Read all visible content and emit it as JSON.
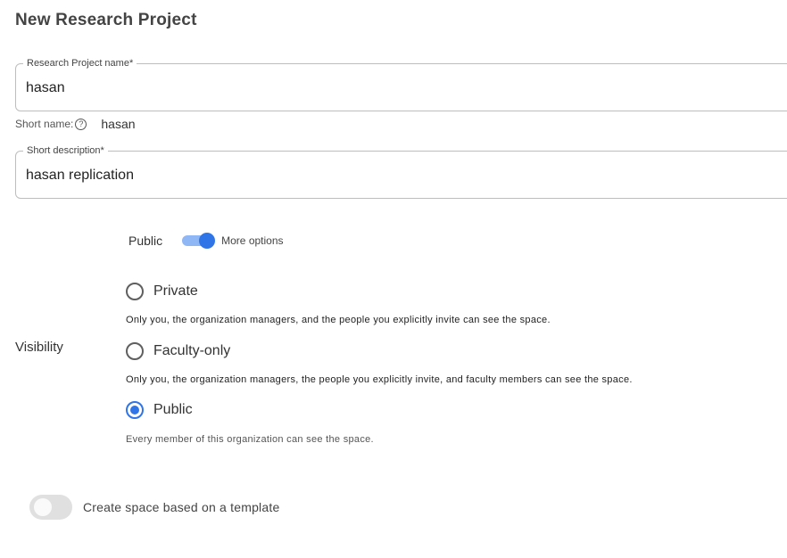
{
  "page": {
    "title": "New Research Project"
  },
  "project_name": {
    "label": "Research Project name*",
    "value": "hasan"
  },
  "short_name": {
    "label": "Short name:",
    "help_icon": "?",
    "value": "hasan"
  },
  "short_description": {
    "label": "Short description*",
    "value": "hasan replication"
  },
  "visibility": {
    "label": "Visibility",
    "toggle": {
      "label": "Public",
      "state": "on",
      "more_options": "More options"
    },
    "options": [
      {
        "label": "Private",
        "selected": false,
        "description": "Only you, the organization managers, and the people you explicitly invite can see the space."
      },
      {
        "label": "Faculty-only",
        "selected": false,
        "description": "Only you, the organization managers, the people you explicitly invite, and faculty members can see the space."
      },
      {
        "label": "Public",
        "selected": true,
        "description": "Every member of this organization can see the space."
      }
    ]
  },
  "template": {
    "label": "Create space based on a template",
    "state": "off"
  },
  "colors": {
    "accent": "#2f75e8",
    "accent_light": "#8fb6f5",
    "switch_off": "#e0e0e0"
  }
}
